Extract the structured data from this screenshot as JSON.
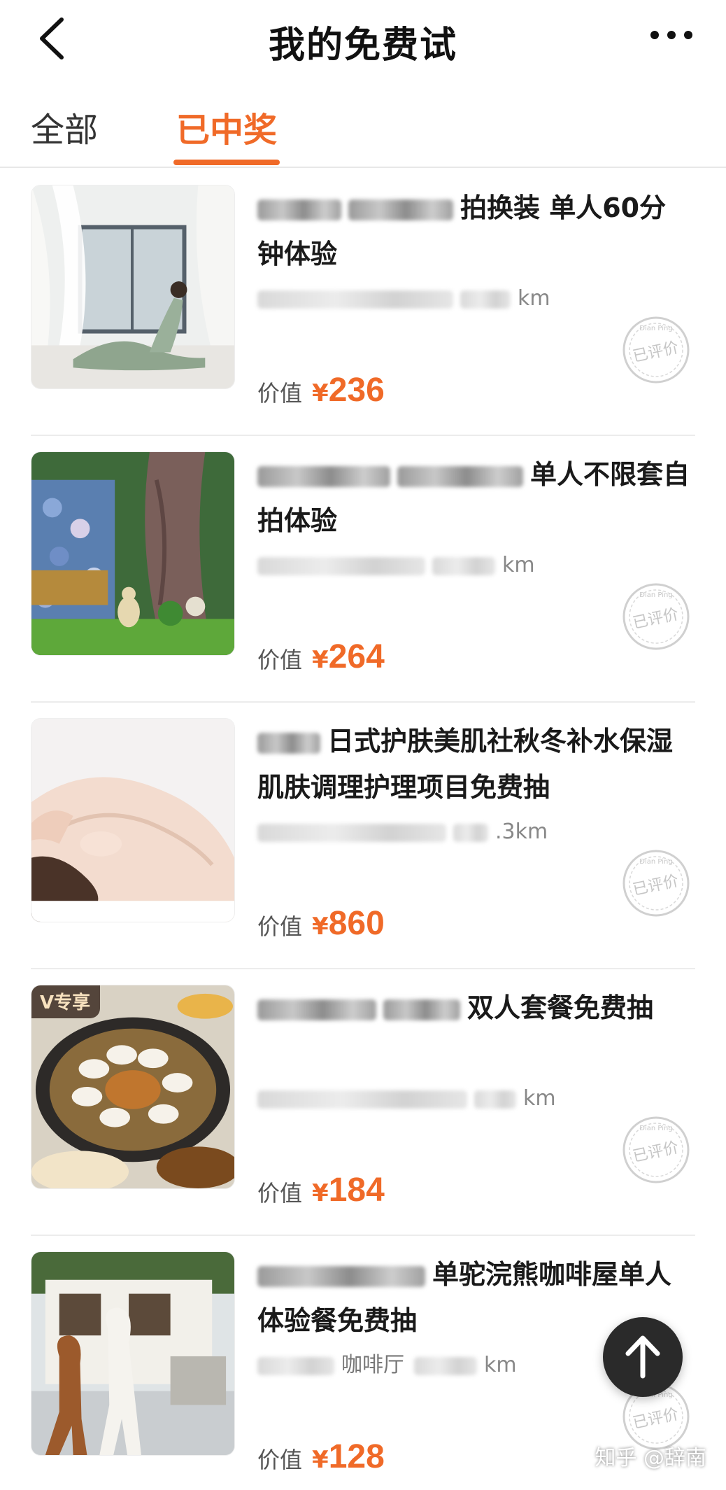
{
  "header": {
    "title": "我的免费试",
    "back_icon": "chevron-left-icon",
    "more_icon": "more-dots-icon"
  },
  "tabs": [
    {
      "label": "全部",
      "active": false
    },
    {
      "label": "已中奖",
      "active": true
    }
  ],
  "accent_color": "#f06a28",
  "items": [
    {
      "title_visible": "拍换装 单人60分钟体验",
      "distance_suffix": "km",
      "price_label": "价值",
      "currency": "¥",
      "price": "236",
      "stamp_text": "已评价",
      "stamp_sub": "Dian Ping",
      "badge": ""
    },
    {
      "title_visible": "单人不限套自拍体验",
      "distance_suffix": "km",
      "price_label": "价值",
      "currency": "¥",
      "price": "264",
      "stamp_text": "已评价",
      "stamp_sub": "Dian Ping",
      "badge": ""
    },
    {
      "title_visible": "日式护肤美肌社秋冬补水保湿肌肤调理护理项目免费抽",
      "distance_suffix": ".3km",
      "price_label": "价值",
      "currency": "¥",
      "price": "860",
      "stamp_text": "已评价",
      "stamp_sub": "Dian Ping",
      "badge": ""
    },
    {
      "title_visible": "双人套餐免费抽",
      "distance_suffix": "km",
      "price_label": "价值",
      "currency": "¥",
      "price": "184",
      "stamp_text": "已评价",
      "stamp_sub": "Dian Ping",
      "badge": "V专享"
    },
    {
      "title_visible": "单驼浣熊咖啡屋单人体验餐免费抽",
      "distance_suffix": "km",
      "address_visible": "咖啡厅",
      "price_label": "价值",
      "currency": "¥",
      "price": "128",
      "stamp_text": "已评价",
      "stamp_sub": "Dian Ping",
      "badge": ""
    }
  ],
  "floating": {
    "back_to_top_icon": "arrow-up-icon",
    "watermark": "知乎 @辞南"
  }
}
